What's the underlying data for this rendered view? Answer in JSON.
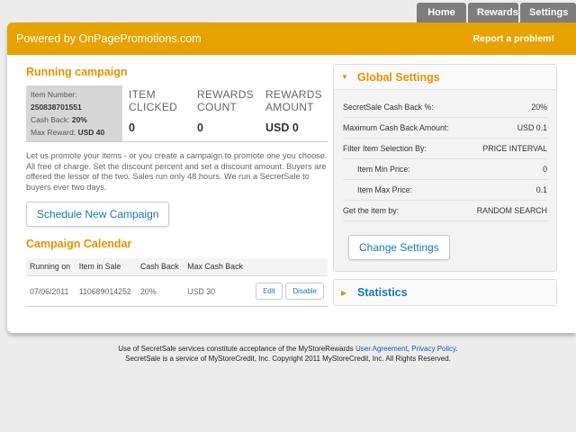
{
  "nav": {
    "home": "Home",
    "rewards": "Rewards",
    "settings": "Settings"
  },
  "banner": {
    "brand": "Powered by OnPagePromotions.com",
    "report": "Report a problem!"
  },
  "campaign": {
    "heading": "Running campaign",
    "item_number_label": "Item Number:",
    "item_number": "250838701551",
    "cash_back_label": "Cash Back:",
    "cash_back": "20%",
    "max_reward_label": "Max Reward:",
    "max_reward": "USD 40",
    "stats": [
      {
        "label": "ITEM CLICKED",
        "value": "0"
      },
      {
        "label": "REWARDS COUNT",
        "value": "0"
      },
      {
        "label": "REWARDS AMOUNT",
        "value": "USD 0"
      }
    ],
    "description": "Let us promote your items - or you create a campaign to promote one you choose. All free of charge. Set the discount percent and set a discount amount. Buyers are offered the lessor of the two. Sales run only 48 hours. We run a SecretSale to buyers ever two days.",
    "schedule_button": "Schedule New Campaign"
  },
  "calendar": {
    "heading": "Campaign Calendar",
    "columns": [
      "Running on",
      "Item in Sale",
      "Cash Back",
      "Max Cash Back"
    ],
    "rows": [
      {
        "running_on": "07/06/2011",
        "item": "110689014252",
        "cash_back": "20%",
        "max_cash_back": "USD 30",
        "edit": "Edit",
        "disable": "Disable"
      }
    ]
  },
  "global_settings": {
    "title": "Global Settings",
    "rows": [
      {
        "key": "SecretSale Cash Back %:",
        "value": "20%"
      },
      {
        "key": "Maximum Cash Back Amount:",
        "value": "USD 0.1"
      },
      {
        "key": "Filter Item Selection By:",
        "value": "PRICE INTERVAL"
      },
      {
        "key": "Item Min Price:",
        "value": "0"
      },
      {
        "key": "Item Max Price:",
        "value": "0.1"
      },
      {
        "key": "Get the item by:",
        "value": "RANDOM SEARCH"
      }
    ],
    "change_button": "Change Settings"
  },
  "statistics": {
    "title": "Statistics"
  },
  "footer": {
    "line1_prefix": "Use of SecretSale services constitute acceptance of the MyStoreRewards",
    "user_agreement": "User Agreement",
    "comma": ",",
    "privacy_policy": "Privacy Policy",
    "period": ".",
    "line2": "SecretSale is a service of MyStoreCredit, Inc. Copyright 2011 MyStoreCredit, Inc. All Rights Reserved."
  },
  "colors": {
    "accent": "#e8a200",
    "link": "#1a77b5",
    "nav_tab": "#7d7d7d"
  },
  "icons": {
    "expanded": "triangle-down-icon",
    "collapsed": "triangle-right-icon"
  }
}
